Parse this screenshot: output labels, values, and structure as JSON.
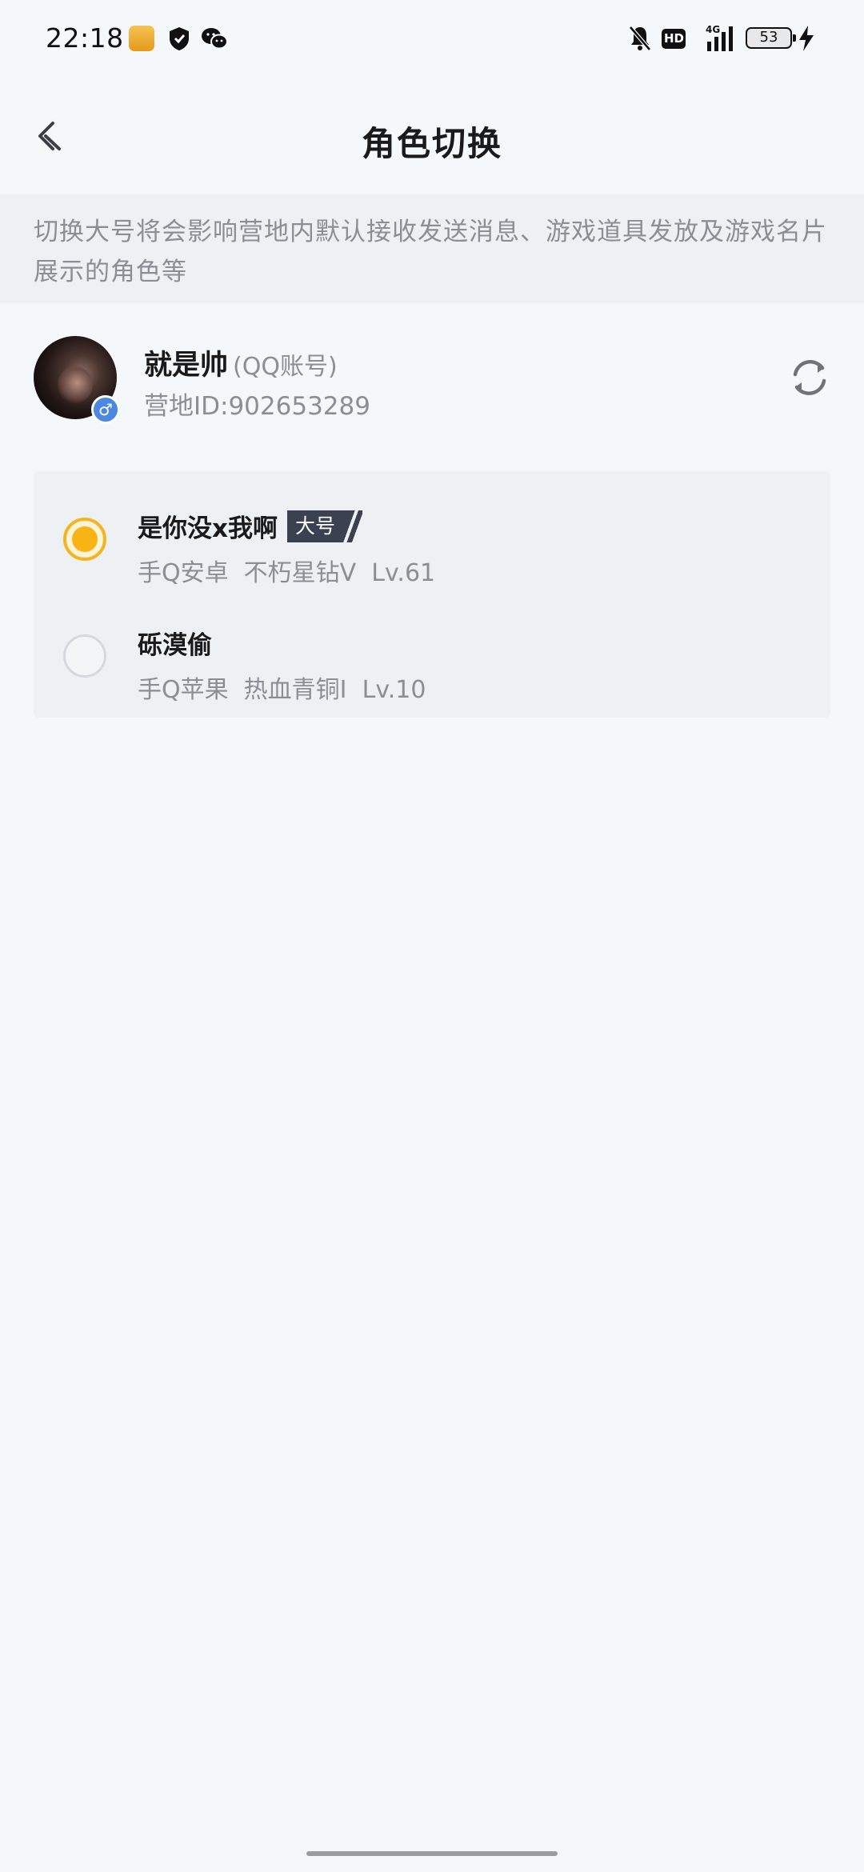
{
  "status_bar": {
    "time": "22:18",
    "hd_label": "HD",
    "battery_level": "53",
    "signal_label": "4G"
  },
  "header": {
    "title": "角色切换",
    "back_icon": "chevron-left-icon"
  },
  "notice": {
    "text": "切换大号将会影响营地内默认接收发送消息、游戏道具发放及游戏名片展示的角色等"
  },
  "account": {
    "name": "就是帅",
    "type": "(QQ账号)",
    "id_text": "营地ID:902653289",
    "gender_symbol": "♂",
    "refresh_icon": "refresh-icon"
  },
  "roles": [
    {
      "name": "是你没x我啊",
      "tag": "大号",
      "detail": "手Q安卓  不朽星钻V  Lv.61",
      "selected": true
    },
    {
      "name": "砾漠偷",
      "tag": "",
      "detail": "手Q苹果  热血青铜I  Lv.10",
      "selected": false
    }
  ],
  "colors": {
    "accent": "#f8b315",
    "background": "#f5f8fb",
    "secondary_text": "#8a8f96",
    "tag_bg": "#3a4150"
  }
}
